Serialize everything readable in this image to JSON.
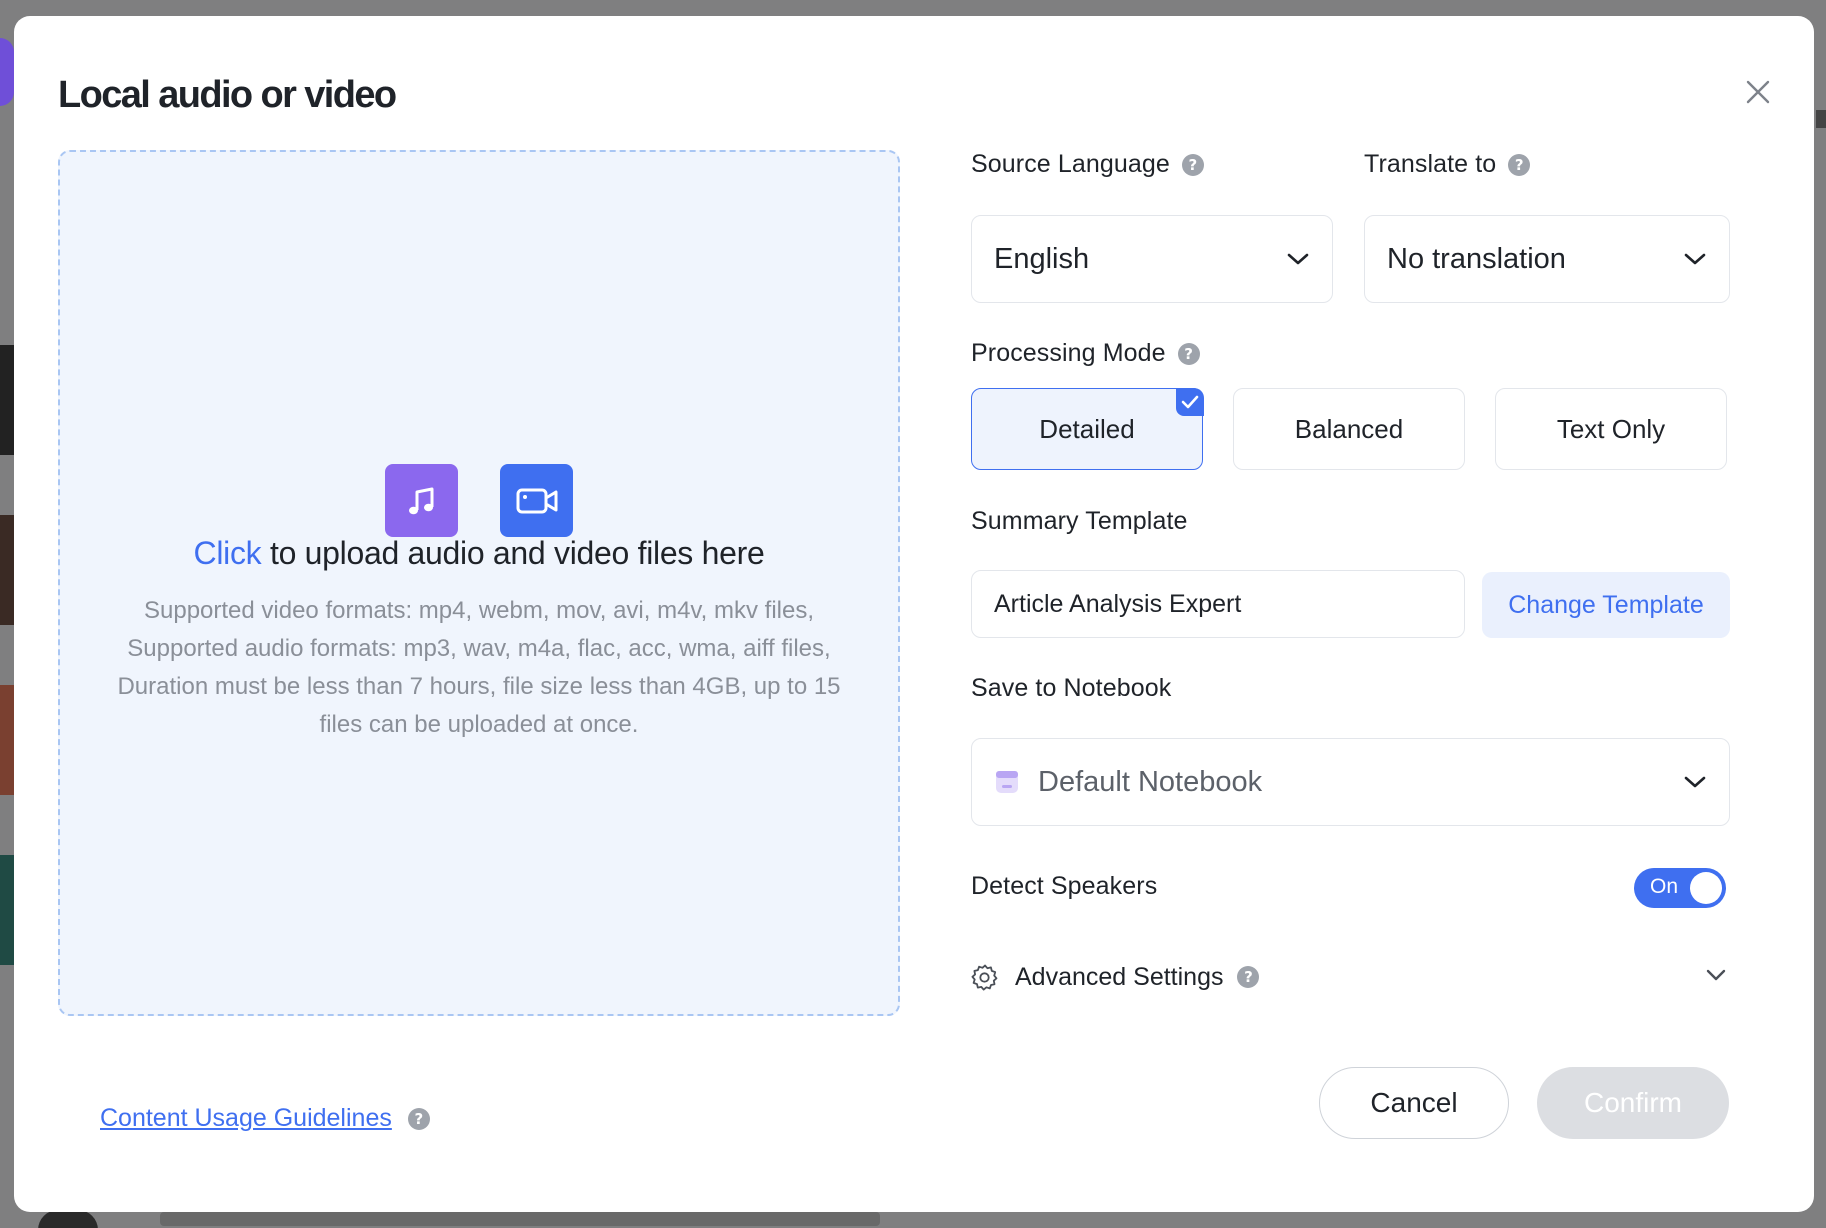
{
  "dialog": {
    "title": "Local audio or video"
  },
  "upload": {
    "click_text": "Click",
    "headline_rest": " to upload audio and video files here",
    "description": "Supported video formats: mp4, webm, mov, avi, m4v, mkv files, Supported audio formats: mp3, wav, m4a, flac, acc, wma, aiff files, Duration must be less than 7 hours, file size less than 4GB, up to 15 files can be uploaded at once."
  },
  "source_language": {
    "label": "Source Language",
    "value": "English"
  },
  "translate_to": {
    "label": "Translate to",
    "value": "No translation"
  },
  "processing_mode": {
    "label": "Processing Mode",
    "options": [
      "Detailed",
      "Balanced",
      "Text Only"
    ],
    "selected": "Detailed"
  },
  "summary_template": {
    "label": "Summary Template",
    "value": "Article Analysis Expert",
    "change_label": "Change Template"
  },
  "notebook": {
    "label": "Save to Notebook",
    "value": "Default Notebook"
  },
  "detect_speakers": {
    "label": "Detect Speakers",
    "toggle_text": "On",
    "enabled": true
  },
  "advanced": {
    "label": "Advanced Settings"
  },
  "footer": {
    "guidelines_link": "Content Usage Guidelines",
    "cancel_label": "Cancel",
    "confirm_label": "Confirm"
  },
  "colors": {
    "accent": "#3f6ff0",
    "audio_icon_bg": "#8b68ee",
    "dropzone_bg": "#f0f5fd",
    "confirm_disabled": "#dcdee2"
  },
  "icons": {
    "close": "close-icon",
    "audio": "music-note-icon",
    "video": "video-camera-icon",
    "help": "help-icon",
    "chevron": "chevron-down-icon",
    "notebook": "notebook-icon",
    "gear": "gear-icon",
    "check": "check-icon"
  }
}
